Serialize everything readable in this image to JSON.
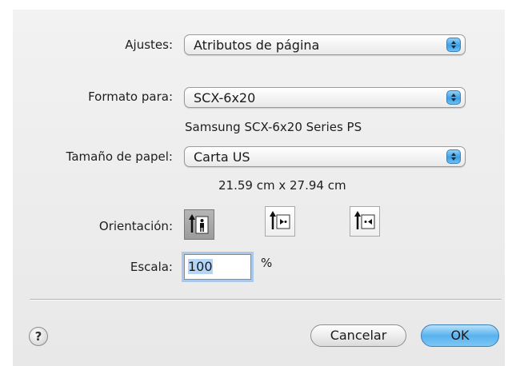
{
  "dialog": {
    "settings": {
      "label": "Ajustes:",
      "value": "Atributos de página"
    },
    "format_for": {
      "label": "Formato para:",
      "value": "SCX-6x20",
      "description": "Samsung SCX-6x20 Series PS"
    },
    "paper_size": {
      "label": "Tamaño de papel:",
      "value": "Carta US",
      "dimensions": "21.59 cm x 27.94 cm"
    },
    "orientation": {
      "label": "Orientación:",
      "options": [
        "portrait",
        "landscape",
        "reverse-landscape"
      ],
      "selected": "portrait"
    },
    "scale": {
      "label": "Escala:",
      "value": "100",
      "unit": "%"
    },
    "buttons": {
      "help": "?",
      "cancel": "Cancelar",
      "ok": "OK"
    }
  },
  "icons": [
    "chevron-updown-icon",
    "portrait-orientation-icon",
    "landscape-orientation-icon",
    "reverse-landscape-orientation-icon",
    "help-icon"
  ],
  "colors": {
    "accent": "#58b2ee",
    "window": "#ececec"
  }
}
